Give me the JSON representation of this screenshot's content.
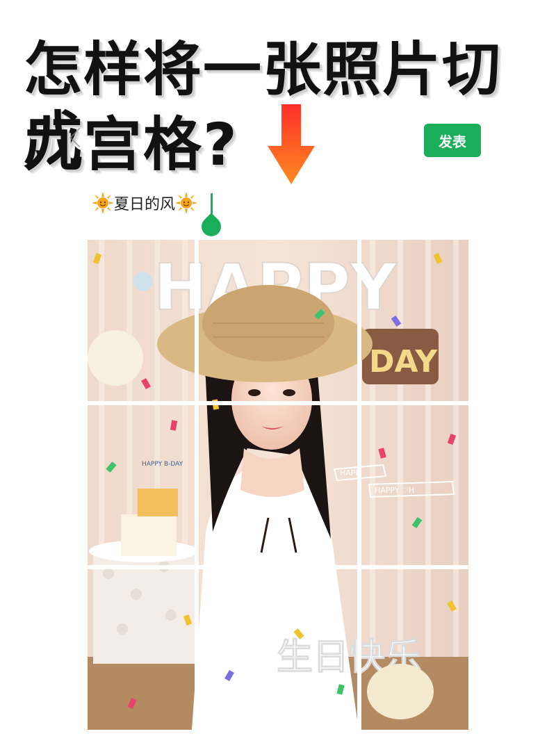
{
  "headline": {
    "line1": "怎样将一张照片切成",
    "line2": "九宫格?"
  },
  "toolbar": {
    "publish_label": "发表"
  },
  "post": {
    "caption_text": "夏日的风",
    "caption_emoji": "sun-emoji"
  },
  "photo": {
    "banner_text": "HAPPY",
    "sign_text": "DAY",
    "overlay_text": "生日快乐",
    "ribbon_text_1": "HAPP",
    "ribbon_text_2": "HAPPY ♡H",
    "cake_topper_text": "HAPPY B-DAY",
    "grid": {
      "rows": 3,
      "cols": 3
    }
  },
  "colors": {
    "accent_green": "#1aae5b",
    "arrow_top": "#ff3b2f",
    "arrow_bottom": "#ff8a1f",
    "headline_text": "#111111"
  },
  "icons": [
    "back-chevron-icon",
    "down-arrow-icon",
    "sun-icon",
    "text-cursor-icon"
  ]
}
